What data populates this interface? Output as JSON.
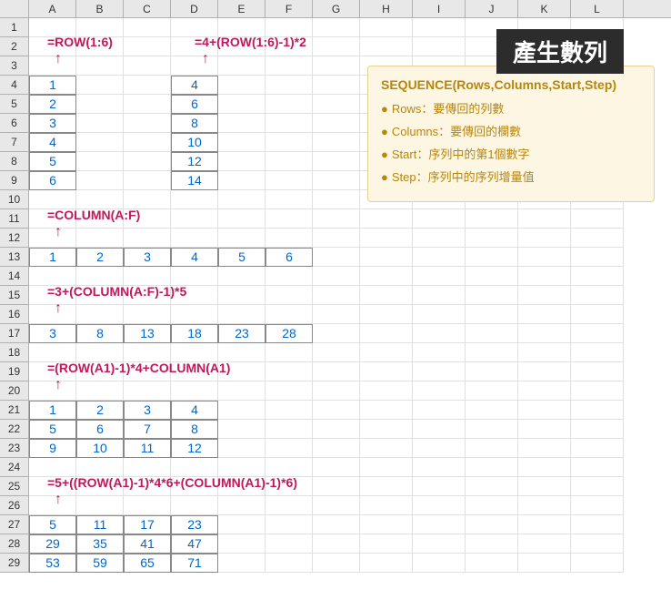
{
  "columns": [
    "A",
    "B",
    "C",
    "D",
    "E",
    "F",
    "G",
    "H",
    "I",
    "J",
    "K",
    "L"
  ],
  "rows": [
    "1",
    "2",
    "3",
    "4",
    "5",
    "6",
    "7",
    "8",
    "9",
    "10",
    "11",
    "12",
    "13",
    "14",
    "15",
    "16",
    "17",
    "18",
    "19",
    "20",
    "21",
    "22",
    "23",
    "24",
    "25",
    "26",
    "27",
    "28",
    "29"
  ],
  "formulas": {
    "f1": "=ROW(1:6)",
    "f2": "=4+(ROW(1:6)-1)*2",
    "f3": "=COLUMN(A:F)",
    "f4": "=3+(COLUMN(A:F)-1)*5",
    "f5": "=(ROW(A1)-1)*4+COLUMN(A1)",
    "f6": "=5+((ROW(A1)-1)*4*6+(COLUMN(A1)-1)*6)"
  },
  "banner": "產生數列",
  "info": {
    "title": "SEQUENCE(Rows,Columns,Start,Step)",
    "i1": "Rows：要傳回的列數",
    "i2": "Columns：要傳回的欄數",
    "i3": "Start：序列中的第1個數字",
    "i4": "Step：序列中的序列增量值"
  },
  "data": {
    "col1": [
      "1",
      "2",
      "3",
      "4",
      "5",
      "6"
    ],
    "col2": [
      "4",
      "6",
      "8",
      "10",
      "12",
      "14"
    ],
    "row1": [
      "1",
      "2",
      "3",
      "4",
      "5",
      "6"
    ],
    "row2": [
      "3",
      "8",
      "13",
      "18",
      "23",
      "28"
    ],
    "grid1": [
      [
        "1",
        "2",
        "3",
        "4"
      ],
      [
        "5",
        "6",
        "7",
        "8"
      ],
      [
        "9",
        "10",
        "11",
        "12"
      ]
    ],
    "grid2": [
      [
        "5",
        "11",
        "17",
        "23"
      ],
      [
        "29",
        "35",
        "41",
        "47"
      ],
      [
        "53",
        "59",
        "65",
        "71"
      ]
    ]
  },
  "arrow": "↑"
}
